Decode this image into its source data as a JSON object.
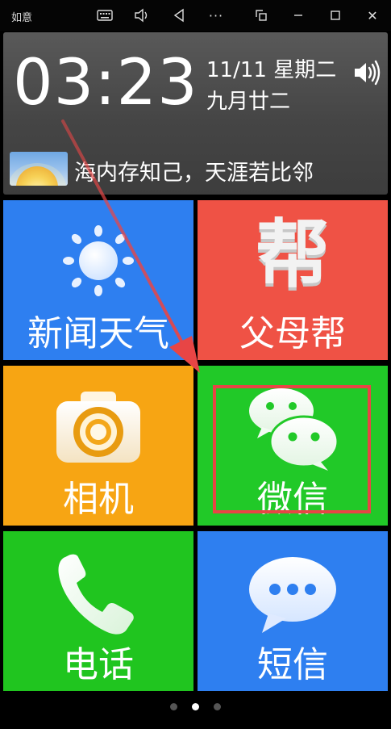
{
  "window": {
    "title": "如意",
    "toolbar_icons": [
      "keyboard-icon",
      "volume-icon",
      "back-icon",
      "more-icon",
      "screenshot-icon",
      "minimize-icon",
      "maximize-icon",
      "close-icon"
    ],
    "more_glyph": "···",
    "close_glyph": "✕"
  },
  "header": {
    "time": "03:23",
    "date": "11/11 星期二",
    "lunar_date": "九月廿二",
    "motto": "海内存知己，天涯若比邻"
  },
  "tiles": [
    {
      "label": "新闻天气",
      "icon": "sun-icon",
      "color": "#2e7ff0"
    },
    {
      "label": "父母帮",
      "icon": "bang-icon",
      "glyph": "帮",
      "color": "#ef5245"
    },
    {
      "label": "相机",
      "icon": "camera-icon",
      "color": "#f7a513"
    },
    {
      "label": "微信",
      "icon": "wechat-icon",
      "color": "#21c928"
    },
    {
      "label": "电话",
      "icon": "phone-icon",
      "color": "#20c51f"
    },
    {
      "label": "短信",
      "icon": "sms-icon",
      "color": "#2e7ff0"
    }
  ],
  "annotation": {
    "arrow_color": "#e84545",
    "highlight_target": "微信"
  },
  "pagination": {
    "pages": 3,
    "current": 2
  }
}
